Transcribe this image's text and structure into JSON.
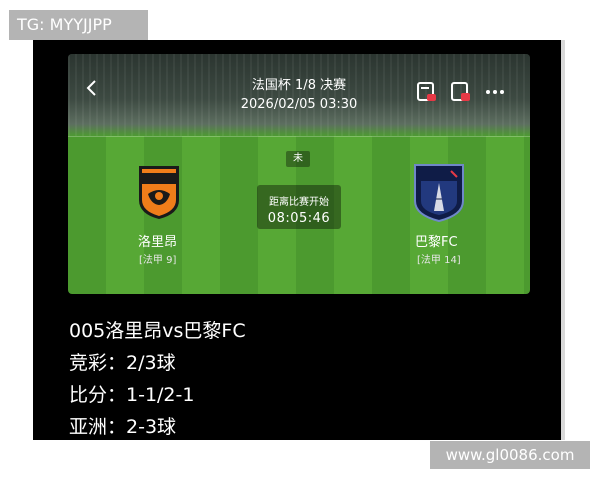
{
  "watermarks": {
    "top_left": "TG: MYYJJPP",
    "bottom_right": "www.gl0086.com"
  },
  "match": {
    "competition": "法国杯 1/8 决赛",
    "datetime": "2026/02/05 03:30",
    "status": "未",
    "countdown_label": "距离比赛开始",
    "countdown": "08:05:46",
    "home": {
      "name": "洛里昂",
      "league": "[法甲 9]",
      "crest_text": "FC LORIENT",
      "crest_color": "#f07d1a"
    },
    "away": {
      "name": "巴黎FC",
      "league": "[法甲 14]",
      "crest_text": "PARIS FC",
      "crest_color": "#1d2f6b"
    }
  },
  "icons": [
    "back-arrow-icon",
    "share-card-icon",
    "notes-icon",
    "more-icon"
  ],
  "colors": {
    "pitch": "#4c9a2f",
    "accent": "#e63946",
    "background": "#000000"
  },
  "post": {
    "title": "005洛里昂vs巴黎FC",
    "line1": "竞彩：2/3球",
    "line2": "比分：1-1/2-1",
    "line3": "亚洲：2-3球"
  }
}
